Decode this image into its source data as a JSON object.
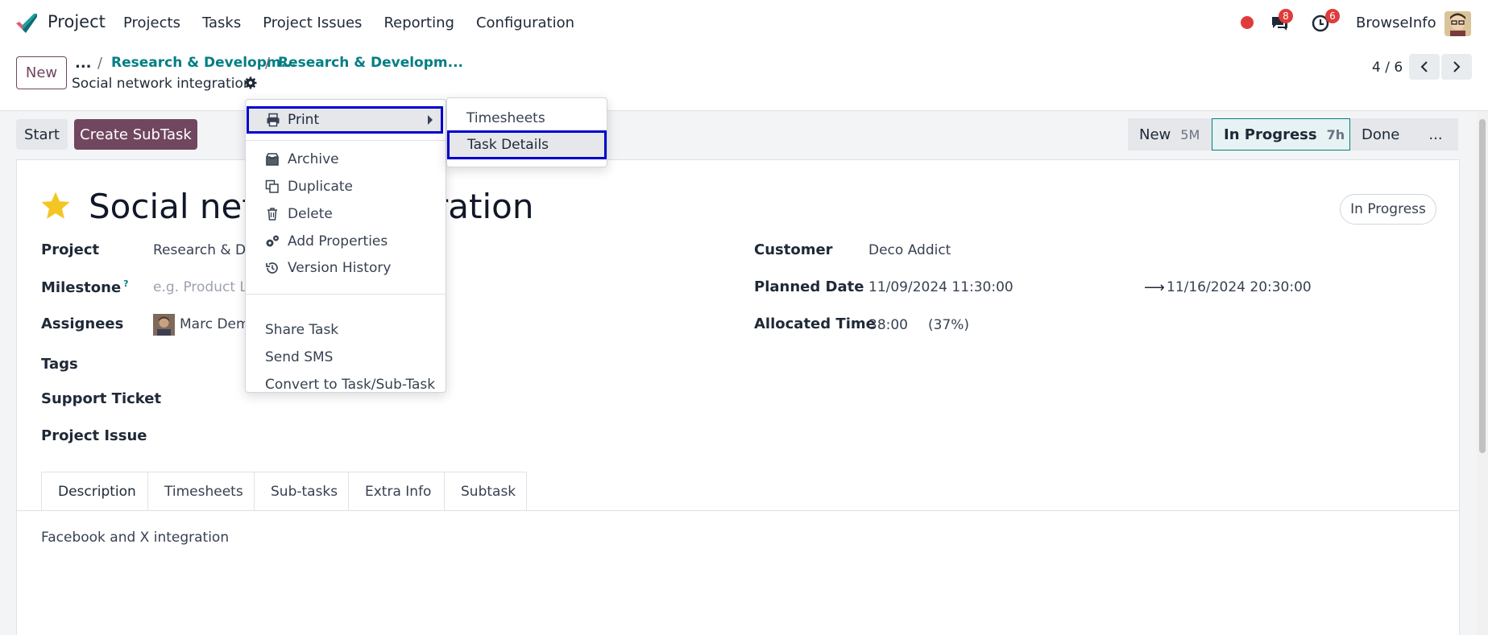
{
  "app": {
    "name": "Project",
    "user": "BrowseInfo",
    "messages_count": "8",
    "activities_count": "6"
  },
  "menu": [
    "Projects",
    "Tasks",
    "Project Issues",
    "Reporting",
    "Configuration"
  ],
  "control_panel": {
    "new_label": "New",
    "breadcrumb_dots": "...",
    "breadcrumbs": [
      "Research & Developm...",
      "Research & Developm..."
    ],
    "record_name": "Social network integration",
    "pager": "4 / 6"
  },
  "actions": {
    "start": "Start",
    "create_subtask": "Create SubTask"
  },
  "stages": [
    {
      "name": "New",
      "meta": "5M"
    },
    {
      "name": "In Progress",
      "meta": "7h"
    },
    {
      "name": "Done",
      "meta": ""
    },
    {
      "name": "...",
      "meta": ""
    }
  ],
  "task": {
    "title": "Social network integration",
    "status": "In Progress",
    "fields_left": {
      "project_label": "Project",
      "project_value": "Research & De",
      "milestone_label": "Milestone",
      "milestone_help": "?",
      "milestone_placeholder": "e.g. Product La",
      "assignees_label": "Assignees",
      "assignee_name": "Marc Demo",
      "tags_label": "Tags",
      "support_ticket_label": "Support Ticket",
      "project_issue_label": "Project Issue"
    },
    "fields_right": {
      "customer_label": "Customer",
      "customer_value": "Deco Addict",
      "planned_label": "Planned Date",
      "planned_start": "11/09/2024 11:30:00",
      "planned_end": "11/16/2024 20:30:00",
      "allocated_label": "Allocated Time",
      "allocated_value": "38:00",
      "allocated_pct": "(37%)"
    }
  },
  "tabs": [
    "Description",
    "Timesheets",
    "Sub-tasks",
    "Extra Info",
    "Subtask"
  ],
  "description": "Facebook and X integration",
  "dropdown": {
    "print": "Print",
    "archive": "Archive",
    "duplicate": "Duplicate",
    "delete": "Delete",
    "add_properties": "Add Properties",
    "version_history": "Version History",
    "share_task": "Share Task",
    "send_sms": "Send SMS",
    "convert": "Convert to Task/Sub-Task"
  },
  "submenu": {
    "timesheets": "Timesheets",
    "task_details": "Task Details"
  },
  "colors": {
    "brand": "#71465f",
    "link": "#017e84",
    "highlight": "#0000cc",
    "badge": "#e03b3b"
  }
}
